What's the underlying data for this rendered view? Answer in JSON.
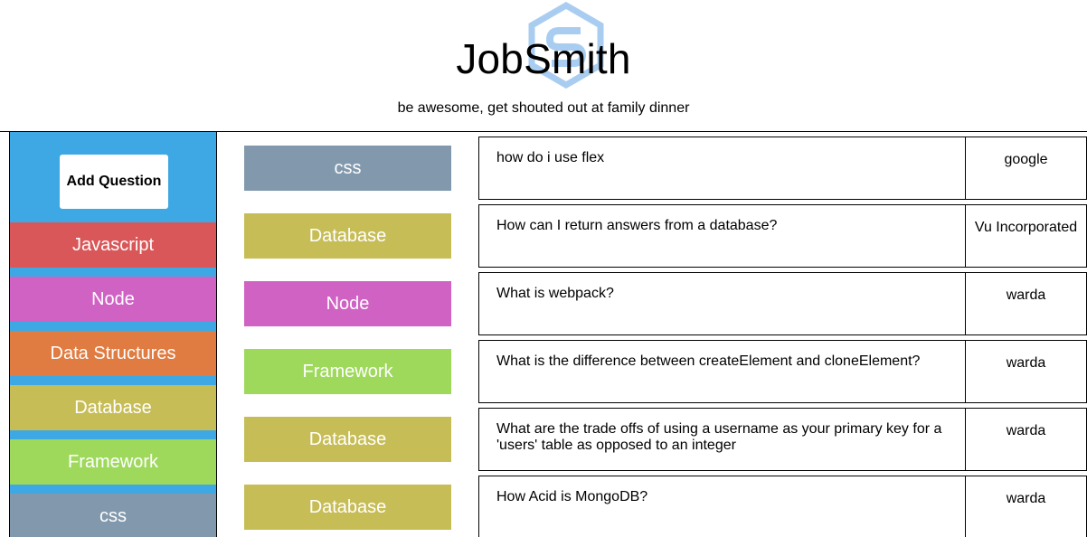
{
  "header": {
    "title": "JobSmith",
    "subtitle": "be awesome, get shouted out at family dinner",
    "logo_icon": "hexagon-s-logo-icon",
    "logo_color": "#a9cdf0"
  },
  "sidebar": {
    "background": "#3ea8e4",
    "add_question_label": "Add Question",
    "categories": [
      {
        "label": "Javascript",
        "color": "#d95758"
      },
      {
        "label": "Node",
        "color": "#d062c4"
      },
      {
        "label": "Data Structures",
        "color": "#e07b41"
      },
      {
        "label": "Database",
        "color": "#c7bd57"
      },
      {
        "label": "Framework",
        "color": "#9ed95c"
      },
      {
        "label": "css",
        "color": "#8299ad"
      }
    ]
  },
  "questions": [
    {
      "tag": "css",
      "tag_color": "#8299ad",
      "question": "how do i use flex",
      "author": "google"
    },
    {
      "tag": "Database",
      "tag_color": "#c7bd57",
      "question": "How can I return answers from a database?",
      "author": "Vu Incorporated"
    },
    {
      "tag": "Node",
      "tag_color": "#d062c4",
      "question": "What is webpack?",
      "author": "warda"
    },
    {
      "tag": "Framework",
      "tag_color": "#9ed95c",
      "question": "What is the difference between createElement and cloneElement?",
      "author": "warda"
    },
    {
      "tag": "Database",
      "tag_color": "#c7bd57",
      "question": "What are the trade offs of using a username as your primary key for a 'users' table as opposed to an integer",
      "author": "warda"
    },
    {
      "tag": "Database",
      "tag_color": "#c7bd57",
      "question": "How Acid is MongoDB?",
      "author": "warda"
    }
  ]
}
